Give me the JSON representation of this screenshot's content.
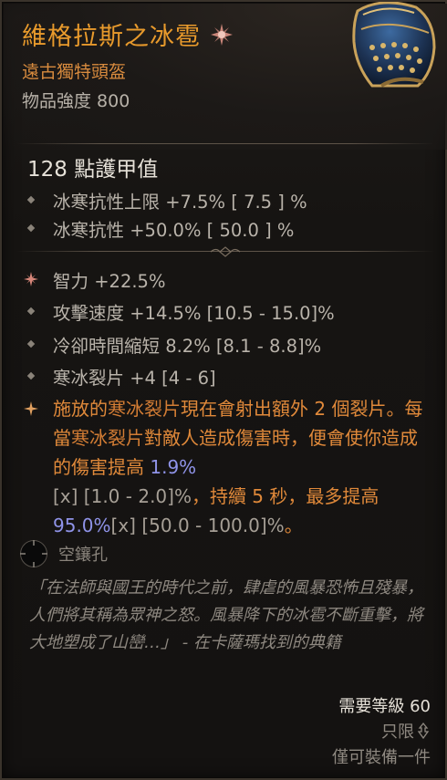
{
  "item": {
    "name": "維格拉斯之冰雹",
    "type": "遠古獨特頭盔",
    "power": "物品強度 800"
  },
  "armor": "128 點護甲值",
  "implicit_stats": [
    "冰寒抗性上限 +7.5%  [ 7.5 ] %",
    "冰寒抗性 +50.0%  [ 50.0 ] %"
  ],
  "affixes": [
    "智力 +22.5%",
    "攻擊速度 +14.5% [10.5 - 15.0]%",
    "冷卻時間縮短 8.2% [8.1 - 8.8]%",
    "寒冰裂片 +4 [4 - 6]"
  ],
  "aspect": {
    "p1": "施放的",
    "p2": "寒冰裂片",
    "p3": "現在會射出額外 2 個裂片。每當",
    "p4": "寒冰裂片",
    "p5": "對敵人造成傷害時，便會使你造成的傷害提高",
    "v1": "1.9%",
    "r1": "[x] [1.0 - 2.0]%",
    "p6": "，持續 5 秒，最多提高",
    "v2": "95.0%",
    "r2": "[x] [50.0 - 100.0]%",
    "p7": "。"
  },
  "socket": {
    "label": "空鑲孔"
  },
  "flavor_text": "「在法師與國王的時代之前，肆虐的風暴恐怖且殘暴，人們將其稱為眾神之怒。風暴降下的冰雹不斷重擊，將大地塑成了山巒…」 - 在卡薩瑪找到的典籍",
  "requirements": {
    "level": "需要等級 60",
    "account_bound": "只限",
    "equip_limit": "僅可裝備一件"
  },
  "colors": {
    "unique_name": "#e89a2c",
    "aspect_text": "#e0893a",
    "value_highlight": "#8f93e8"
  }
}
